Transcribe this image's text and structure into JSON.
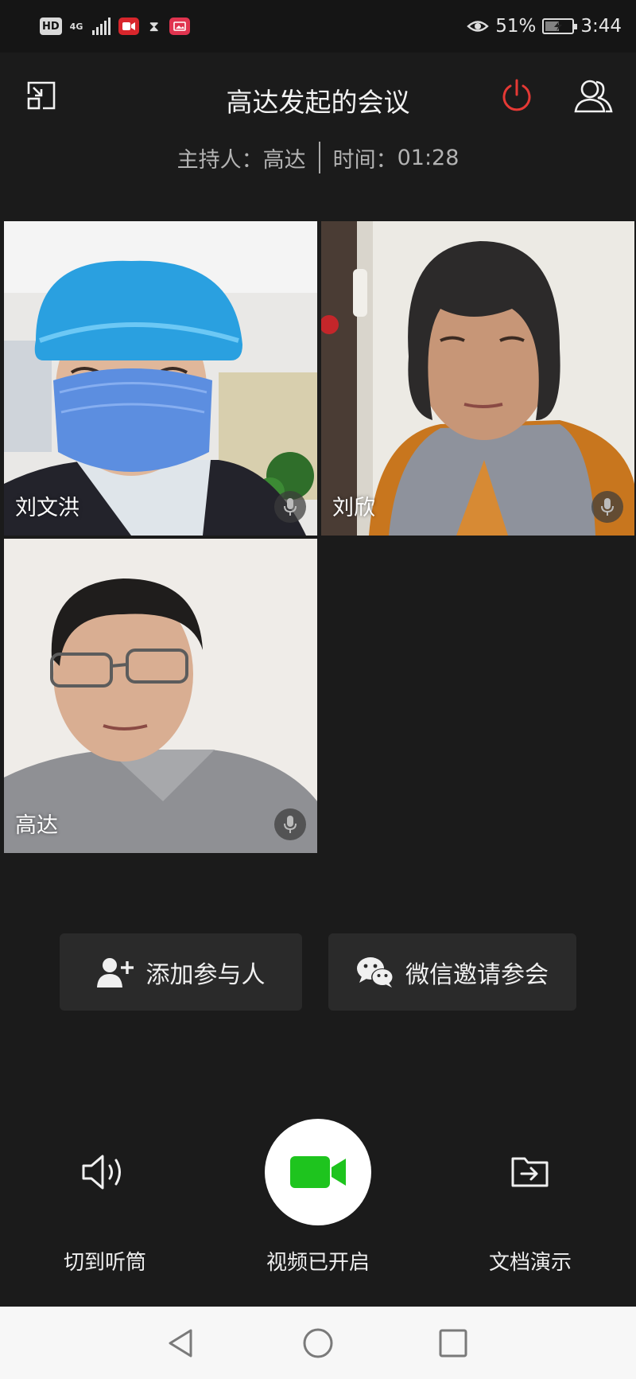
{
  "status_bar": {
    "hd_label": "HD",
    "network_label": "4G",
    "battery_percent": "51%",
    "battery_level": 0.51,
    "time": "3:44",
    "icons": [
      "hd-icon",
      "signal-icon",
      "video-app-icon",
      "hourglass-icon",
      "photo-app-icon",
      "eye-icon",
      "battery-icon"
    ]
  },
  "header": {
    "title": "高达发起的会议",
    "host_label": "主持人：",
    "host_name": "高达",
    "time_label": "时间：",
    "elapsed": "01:28",
    "icons": [
      "minimize-window-icon",
      "power-icon",
      "participants-icon"
    ],
    "end_color": "#e53935"
  },
  "participants": [
    {
      "name": "刘文洪"
    },
    {
      "name": "刘欣"
    },
    {
      "name": "高达"
    }
  ],
  "invite": {
    "add_label": "添加参与人",
    "wechat_label": "微信邀请参会",
    "icons": [
      "add-person-icon",
      "wechat-icon"
    ]
  },
  "controls": {
    "speaker_label": "切到听筒",
    "video_label": "视频已开启",
    "doc_label": "文档演示",
    "video_color": "#1ec41e",
    "icons": [
      "speaker-icon",
      "video-camera-icon",
      "folder-share-icon"
    ]
  },
  "nav": {
    "icons": [
      "back-triangle-icon",
      "home-circle-icon",
      "recents-square-icon"
    ]
  }
}
